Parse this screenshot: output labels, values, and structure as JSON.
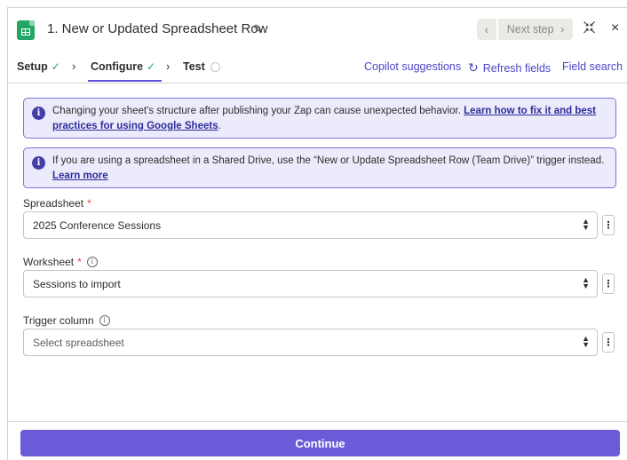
{
  "header": {
    "title": "1. New or Updated Spreadsheet Row",
    "prev_label": "‹",
    "next_label": "Next step",
    "next_chevron": "›",
    "close_label": "×",
    "app_icon": "google-sheets-icon",
    "edit_icon": "pencil-icon",
    "collapse_icon": "collapse-icon"
  },
  "tabs": {
    "setup": "Setup",
    "configure": "Configure",
    "test": "Test",
    "copilot": "Copilot suggestions",
    "refresh": "Refresh fields",
    "field_search": "Field search"
  },
  "banners": {
    "warning_text": "Changing your sheet's structure after publishing your Zap can cause unexpected behavior.",
    "warning_link": "Learn how to fix it and best practices for using Google Sheets",
    "warning_end": ".",
    "shared_text": "If you are using a spreadsheet in a Shared Drive, use the “New or Update Spreadsheet Row (Team Drive)” trigger instead.",
    "shared_link": "Learn more"
  },
  "fields": {
    "spreadsheet": {
      "label": "Spreadsheet",
      "required_mark": "*",
      "value": "2025 Conference Sessions"
    },
    "worksheet": {
      "label": "Worksheet",
      "required_mark": "*",
      "value": "Sessions to import"
    },
    "trigger_column": {
      "label": "Trigger column",
      "placeholder": "Select spreadsheet"
    }
  },
  "footer": {
    "continue_label": "Continue"
  },
  "colors": {
    "accent": "#6a5bd8",
    "link": "#4b46c7",
    "success": "#23a566",
    "banner_bg": "#ecebfb",
    "required": "#e8453c"
  }
}
